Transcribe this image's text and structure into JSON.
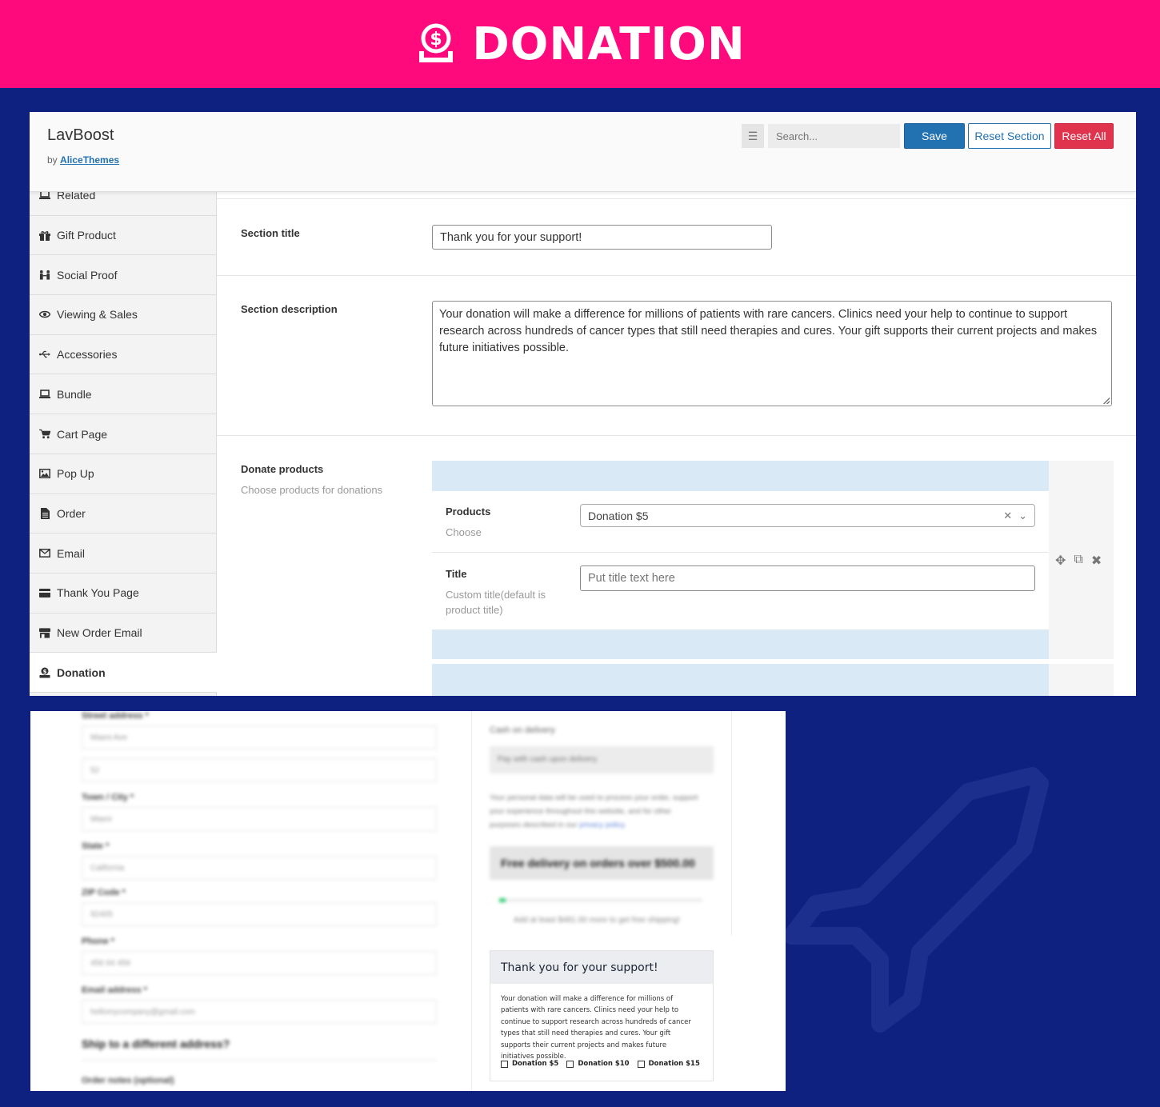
{
  "banner": {
    "title": "DONATION",
    "icon": "donation-hand-dollar-icon"
  },
  "header": {
    "app_title": "LavBoost",
    "by_prefix": "by",
    "by_link": "AliceThemes",
    "search_placeholder": "Search...",
    "save_label": "Save",
    "reset_section_label": "Reset Section",
    "reset_all_label": "Reset All"
  },
  "sidebar": {
    "items": [
      {
        "label": "Related",
        "icon": "laptop-icon"
      },
      {
        "label": "Gift Product",
        "icon": "gift-icon"
      },
      {
        "label": "Social Proof",
        "icon": "people-icon"
      },
      {
        "label": "Viewing & Sales",
        "icon": "eye-icon"
      },
      {
        "label": "Accessories",
        "icon": "usb-icon"
      },
      {
        "label": "Bundle",
        "icon": "laptop-icon"
      },
      {
        "label": "Cart Page",
        "icon": "cart-icon"
      },
      {
        "label": "Pop Up",
        "icon": "image-icon"
      },
      {
        "label": "Order",
        "icon": "file-icon"
      },
      {
        "label": "Email",
        "icon": "envelope-icon"
      },
      {
        "label": "Thank You Page",
        "icon": "credit-card-icon"
      },
      {
        "label": "New Order Email",
        "icon": "store-icon"
      },
      {
        "label": "Donation",
        "icon": "donation-icon",
        "active": true
      }
    ]
  },
  "form": {
    "section_title_label": "Section title",
    "section_title_value": "Thank you for your support!",
    "section_description_label": "Section description",
    "section_description_value": "Your donation will make a difference for millions of patients with rare cancers. Clinics need your help to continue to support research across hundreds of cancer types that still need therapies and cures. Your gift supports their current projects and makes future initiatives possible.",
    "donate_products_label": "Donate products",
    "donate_products_sub": "Choose products for donations",
    "products_label": "Products",
    "products_sub": "Choose",
    "products_value": "Donation $5",
    "title_label": "Title",
    "title_sub": "Custom title(default is product title)",
    "title_placeholder": "Put title text here"
  },
  "preview": {
    "blurred_labels": [
      "Street address *",
      "Town / City *",
      "State *",
      "ZIP Code *",
      "Phone *",
      "Email address *",
      "Order notes (optional)"
    ],
    "blurred_values": [
      "Miami Ave",
      "52",
      "Miami",
      "California",
      "92405",
      "456 64 456",
      "hellomycompany@gmail.com"
    ],
    "ship_label": "Ship to a different address?",
    "payment_method": "Cash on delivery",
    "payment_note": "Pay with cash upon delivery.",
    "privacy_text": "Your personal data will be used to process your order, support your experience throughout this website, and for other purposes described in our",
    "privacy_link": "privacy policy.",
    "free_delivery": "Free delivery on orders over $500.00",
    "shipping_note": "Add at least $481.00 more to get free shipping!",
    "free_delivery_progress": 0.03,
    "thank_you_title": "Thank you for your support!",
    "thank_you_desc": "Your donation will make a difference for millions of patients with rare cancers. Clinics need your help to continue to support research across hundreds of cancer types that still need therapies and cures. Your gift supports their current projects and makes future initiatives possible.",
    "donation_options": [
      "Donation $5",
      "Donation $10",
      "Donation $15"
    ]
  },
  "colors": {
    "banner": "#ff0a7d",
    "background": "#0e2180",
    "save": "#2271b1",
    "reset_all": "#e0334d",
    "repeater_band": "#d9e9f5",
    "progress": "#2ecc71"
  }
}
